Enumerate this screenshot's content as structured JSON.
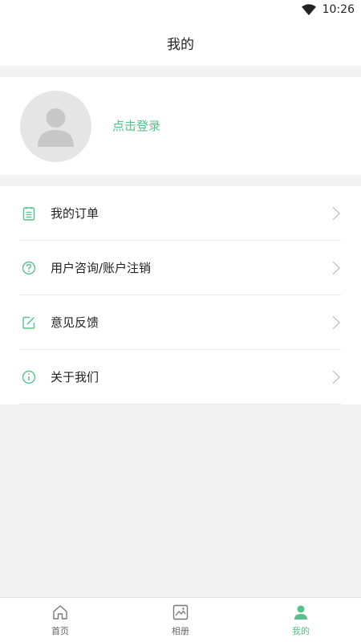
{
  "status_bar": {
    "time": "10:26",
    "wifi_icon": "wifi-icon"
  },
  "header": {
    "title": "我的"
  },
  "profile": {
    "login_text": "点击登录",
    "avatar_icon": "user-placeholder-icon"
  },
  "menu": {
    "items": [
      {
        "label": "我的订单",
        "icon": "order-list-icon"
      },
      {
        "label": "用户咨询/账户注销",
        "icon": "question-circle-icon"
      },
      {
        "label": "意见反馈",
        "icon": "edit-square-icon"
      },
      {
        "label": "关于我们",
        "icon": "info-circle-icon"
      }
    ]
  },
  "tabbar": {
    "tabs": [
      {
        "label": "首页",
        "icon": "home-icon"
      },
      {
        "label": "相册",
        "icon": "album-icon"
      },
      {
        "label": "我的",
        "icon": "user-icon"
      }
    ],
    "active_index": 2
  },
  "colors": {
    "accent": "#56c28a",
    "background": "#f3f3f3",
    "avatar_bg": "#e5e5e5"
  }
}
